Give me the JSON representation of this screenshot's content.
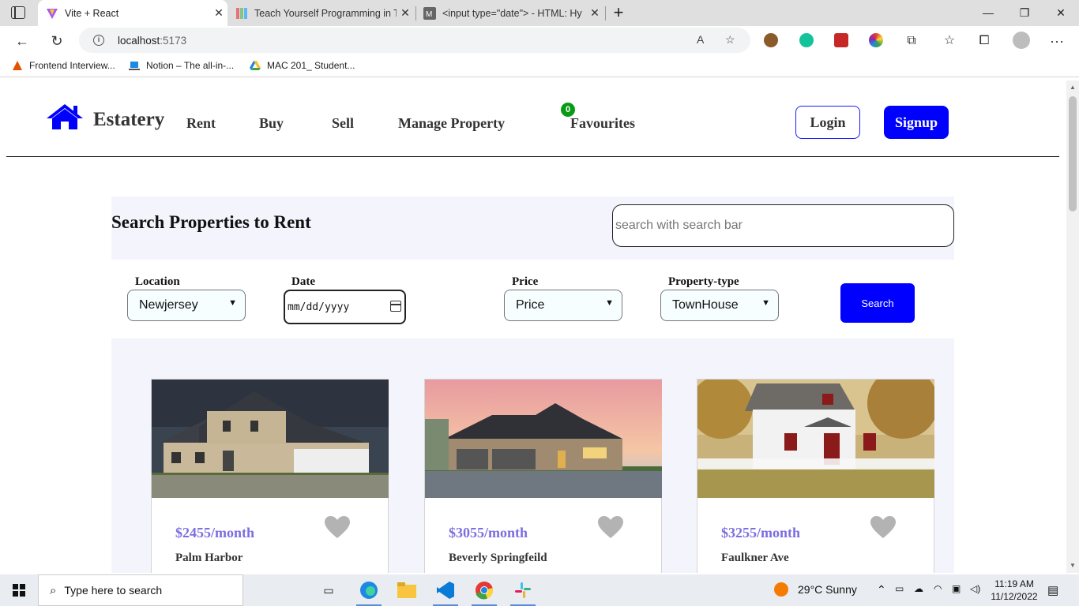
{
  "browser": {
    "tabs": [
      {
        "title": "Vite + React",
        "active": true
      },
      {
        "title": "Teach Yourself Programming in T",
        "active": false
      },
      {
        "title": "<input type=\"date\"> - HTML: Hy",
        "active": false
      }
    ],
    "url_host": "localhost",
    "url_port": ":5173",
    "bookmarks": [
      "Frontend Interview...",
      "Notion – The all-in-...",
      "MAC 201_ Student..."
    ]
  },
  "navbar": {
    "brand": "Estatery",
    "links": [
      "Rent",
      "Buy",
      "Sell",
      "Manage Property"
    ],
    "favourites_label": "Favourites",
    "favourites_count": "0",
    "login_label": "Login",
    "signup_label": "Signup"
  },
  "search": {
    "title": "Search Properties to Rent",
    "placeholder": "search with search bar"
  },
  "filters": {
    "location_label": "Location",
    "location_value": "Newjersey",
    "date_label": "Date",
    "date_value": "mm/dd/yyyy",
    "price_label": "Price",
    "price_value": "Price",
    "type_label": "Property-type",
    "type_value": "TownHouse",
    "search_button": "Search"
  },
  "listings": [
    {
      "price": "$2455/month",
      "name": "Palm Harbor"
    },
    {
      "price": "$3055/month",
      "name": "Beverly Springfeild"
    },
    {
      "price": "$3255/month",
      "name": "Faulkner Ave"
    }
  ],
  "colors": {
    "brand_blue": "#0000ff",
    "price_purple": "#7b6fe0",
    "panel_bg": "#f4f4fd",
    "badge_green": "#0a9b16"
  },
  "taskbar": {
    "search_placeholder": "Type here to search",
    "weather": "29°C  Sunny",
    "time": "11:19 AM",
    "date": "11/12/2022"
  }
}
